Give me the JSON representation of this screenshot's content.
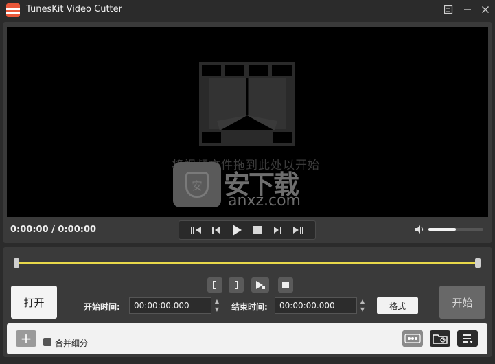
{
  "window": {
    "title": "TunesKit Video Cutter",
    "menu_icon": "menu-list-icon",
    "minimize_icon": "minimize-icon",
    "close_icon": "close-icon"
  },
  "preview": {
    "drop_hint": "将视频文件拖到此处以开始",
    "watermark_cn": "安下载",
    "watermark_en": "anxz.com",
    "watermark_shield": "安"
  },
  "playback": {
    "time_display": "0:00:00 / 0:00:00",
    "volume_level": 0.5
  },
  "edit": {
    "open_label": "打开",
    "start_time_label": "开始时间:",
    "start_time_value": "00:00:00.000",
    "end_time_label": "结束时间:",
    "end_time_value": "00:00:00.000",
    "format_label": "格式",
    "start_button_label": "开始",
    "timeline_color": "#e8d84a"
  },
  "bottom": {
    "add_label": "+",
    "merge_label": "合并细分"
  },
  "colors": {
    "background": "#2b2b2b",
    "panel": "#3a3a3a",
    "accent": "#e9583a"
  }
}
